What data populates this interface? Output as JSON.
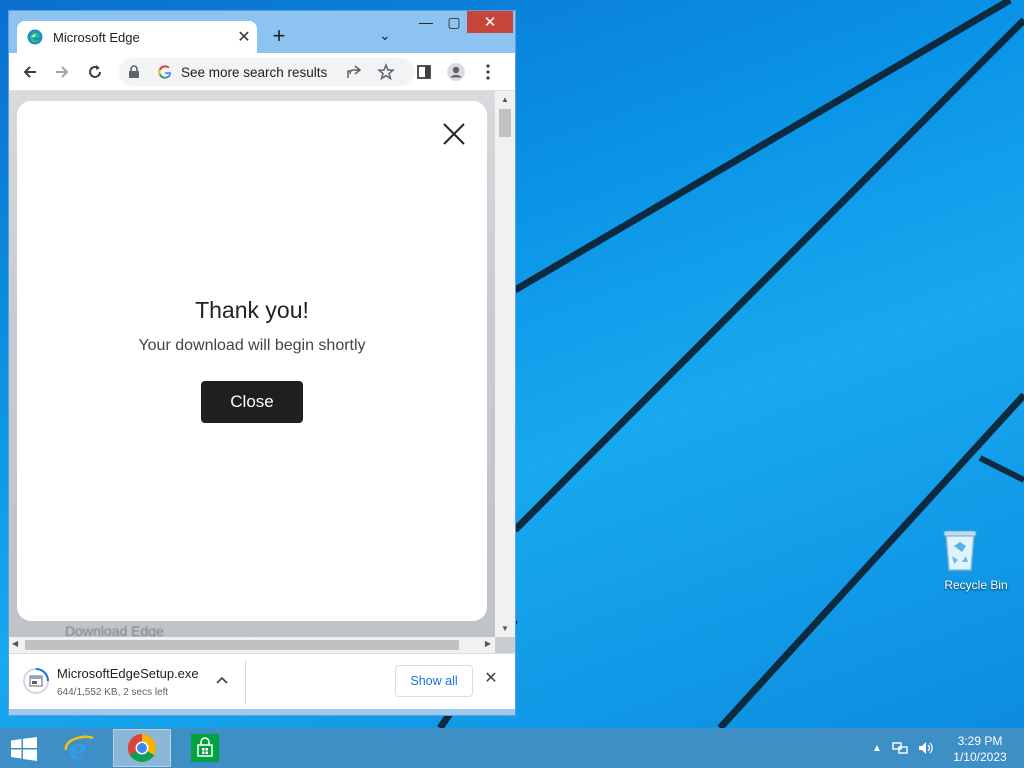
{
  "browser": {
    "tab_title": "Microsoft Edge",
    "new_tab_symbol": "+",
    "tab_close_symbol": "✕",
    "tab_menu_symbol": "⌄",
    "address_text": "See more search results",
    "icons": [
      "back-icon",
      "forward-icon",
      "reload-icon",
      "lock-icon",
      "google-icon",
      "share-icon",
      "star-icon",
      "sidepanel-icon",
      "profile-icon",
      "menu-icon"
    ]
  },
  "window_controls": {
    "minimize": "—",
    "maximize": "▢",
    "close": "✕"
  },
  "page": {
    "background_text": "Download Edge",
    "modal": {
      "title": "Thank you!",
      "subtitle": "Your download will begin shortly",
      "close_button": "Close"
    }
  },
  "downloads": {
    "file_name": "MicrosoftEdgeSetup.exe",
    "status": "644/1,552 KB, 2 secs left",
    "show_all": "Show all",
    "close_symbol": "✕",
    "chevron_symbol": "︿"
  },
  "desktop": {
    "recycle_bin_label": "Recycle Bin"
  },
  "taskbar": {
    "apps": [
      "internet-explorer",
      "chrome",
      "store"
    ],
    "time": "3:29 PM",
    "date": "1/10/2023"
  },
  "colors": {
    "desktop": "#0a93e6",
    "taskbar": "#3f8fc7",
    "modal_button": "#1f1f1f",
    "link_blue": "#1a73e8"
  }
}
